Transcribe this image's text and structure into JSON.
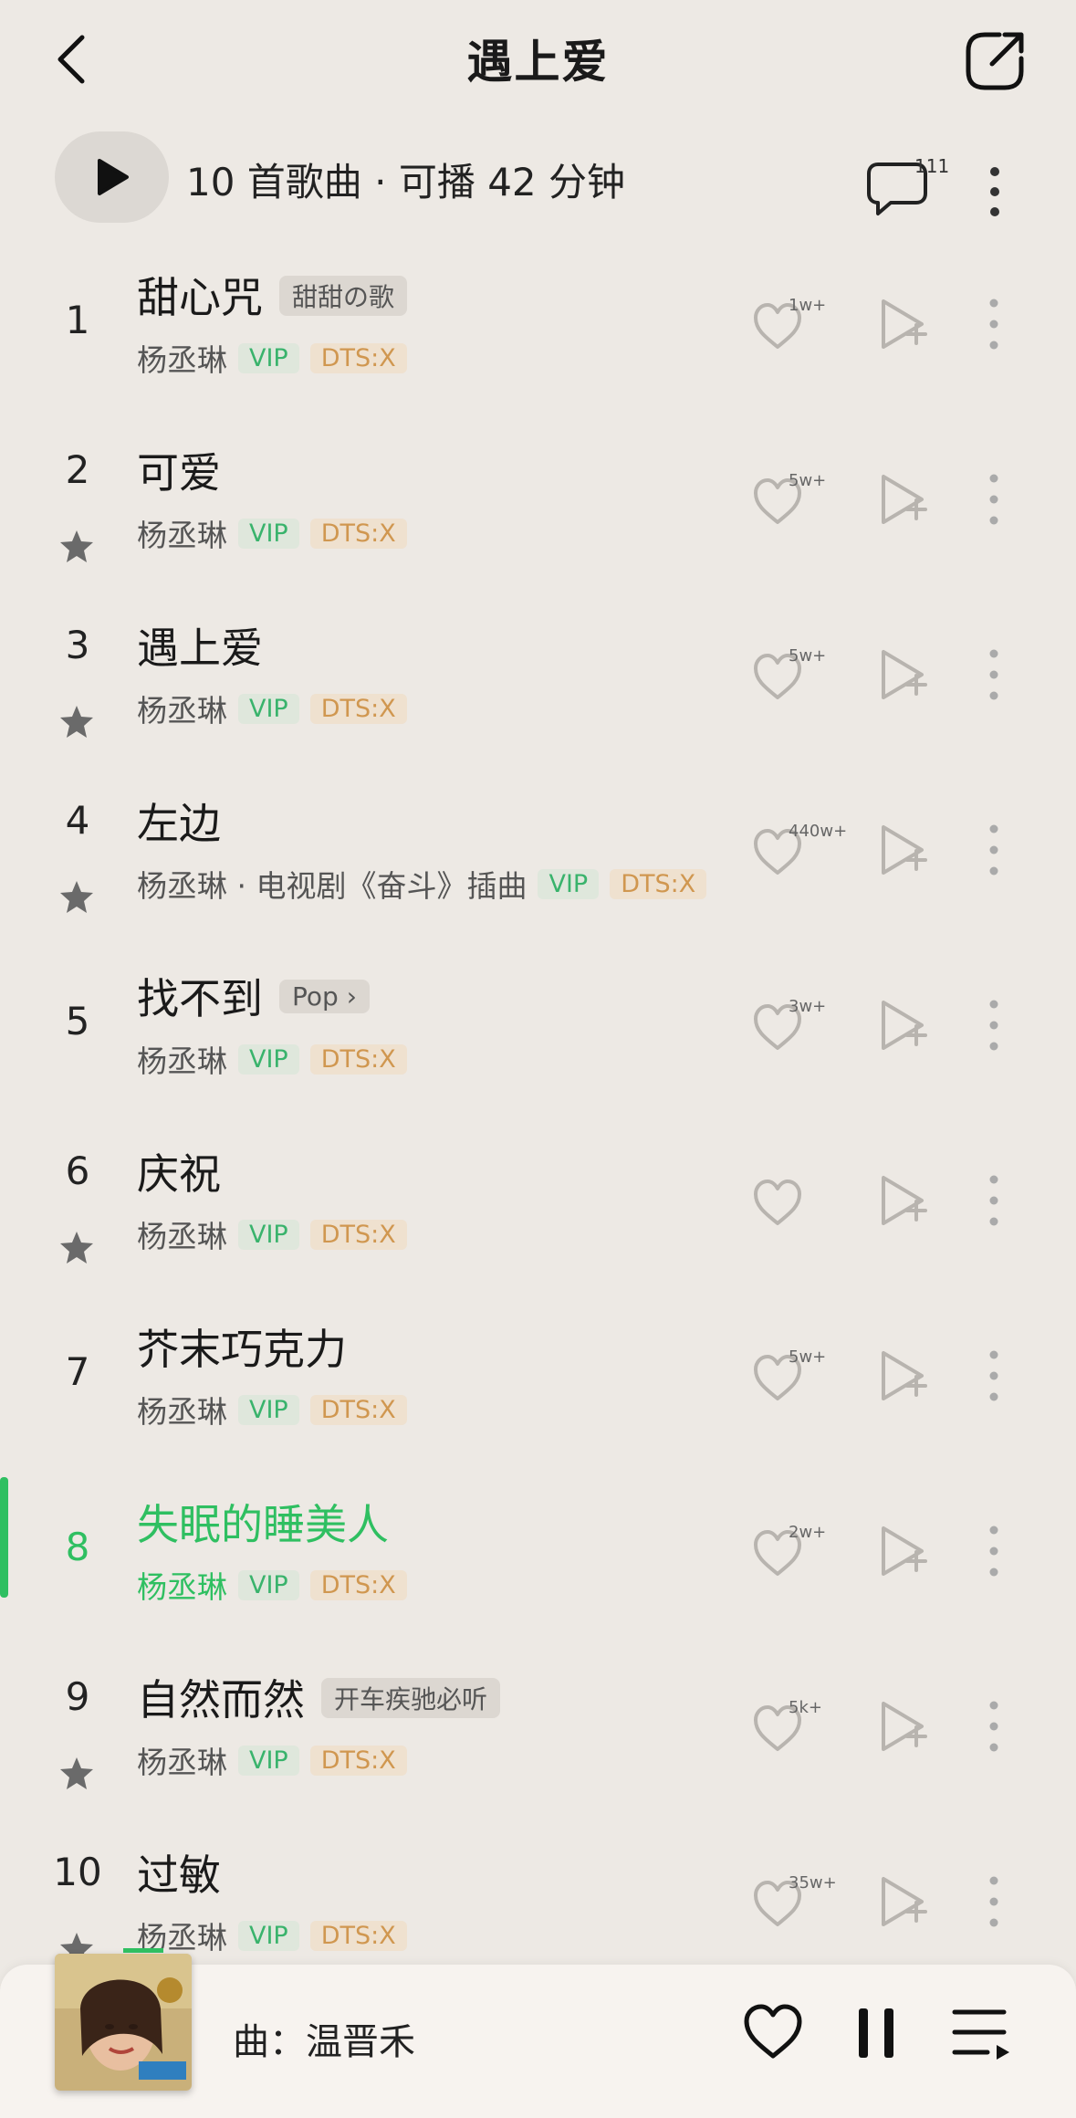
{
  "header": {
    "title": "遇上爱",
    "back_icon": "chevron-left-icon",
    "share_icon": "share-icon"
  },
  "playall": {
    "info": "10 首歌曲 · 可播 42 分钟",
    "comment_count": "111"
  },
  "songs": [
    {
      "num": "1",
      "title": "甜心咒",
      "tag": "甜甜の歌",
      "artist": "杨丞琳",
      "vip": "VIP",
      "dts": "DTS:X",
      "likes": "1w+",
      "star": false
    },
    {
      "num": "2",
      "title": "可爱",
      "tag": "",
      "artist": "杨丞琳",
      "vip": "VIP",
      "dts": "DTS:X",
      "likes": "5w+",
      "star": true
    },
    {
      "num": "3",
      "title": "遇上爱",
      "tag": "",
      "artist": "杨丞琳",
      "vip": "VIP",
      "dts": "DTS:X",
      "likes": "5w+",
      "star": true
    },
    {
      "num": "4",
      "title": "左边",
      "tag": "",
      "artist": "杨丞琳 · 电视剧《奋斗》插曲",
      "vip": "VIP",
      "dts": "DTS:X",
      "likes": "440w+",
      "star": true
    },
    {
      "num": "5",
      "title": "找不到",
      "tag": "Pop ›",
      "artist": "杨丞琳",
      "vip": "VIP",
      "dts": "DTS:X",
      "likes": "3w+",
      "star": false
    },
    {
      "num": "6",
      "title": "庆祝",
      "tag": "",
      "artist": "杨丞琳",
      "vip": "VIP",
      "dts": "DTS:X",
      "likes": "",
      "star": true
    },
    {
      "num": "7",
      "title": "芥末巧克力",
      "tag": "",
      "artist": "杨丞琳",
      "vip": "VIP",
      "dts": "DTS:X",
      "likes": "5w+",
      "star": false
    },
    {
      "num": "8",
      "title": "失眠的睡美人",
      "tag": "",
      "artist": "杨丞琳",
      "vip": "VIP",
      "dts": "DTS:X",
      "likes": "2w+",
      "star": false,
      "active": true
    },
    {
      "num": "9",
      "title": "自然而然",
      "tag": "开车疾驰必听",
      "artist": "杨丞琳",
      "vip": "VIP",
      "dts": "DTS:X",
      "likes": "5k+",
      "star": true
    },
    {
      "num": "10",
      "title": "过敏",
      "tag": "",
      "artist": "杨丞琳",
      "vip": "VIP",
      "dts": "DTS:X",
      "likes": "35w+",
      "star": true
    }
  ],
  "player": {
    "now_playing": "曲：温晋禾",
    "accent": "#2fbf61"
  }
}
